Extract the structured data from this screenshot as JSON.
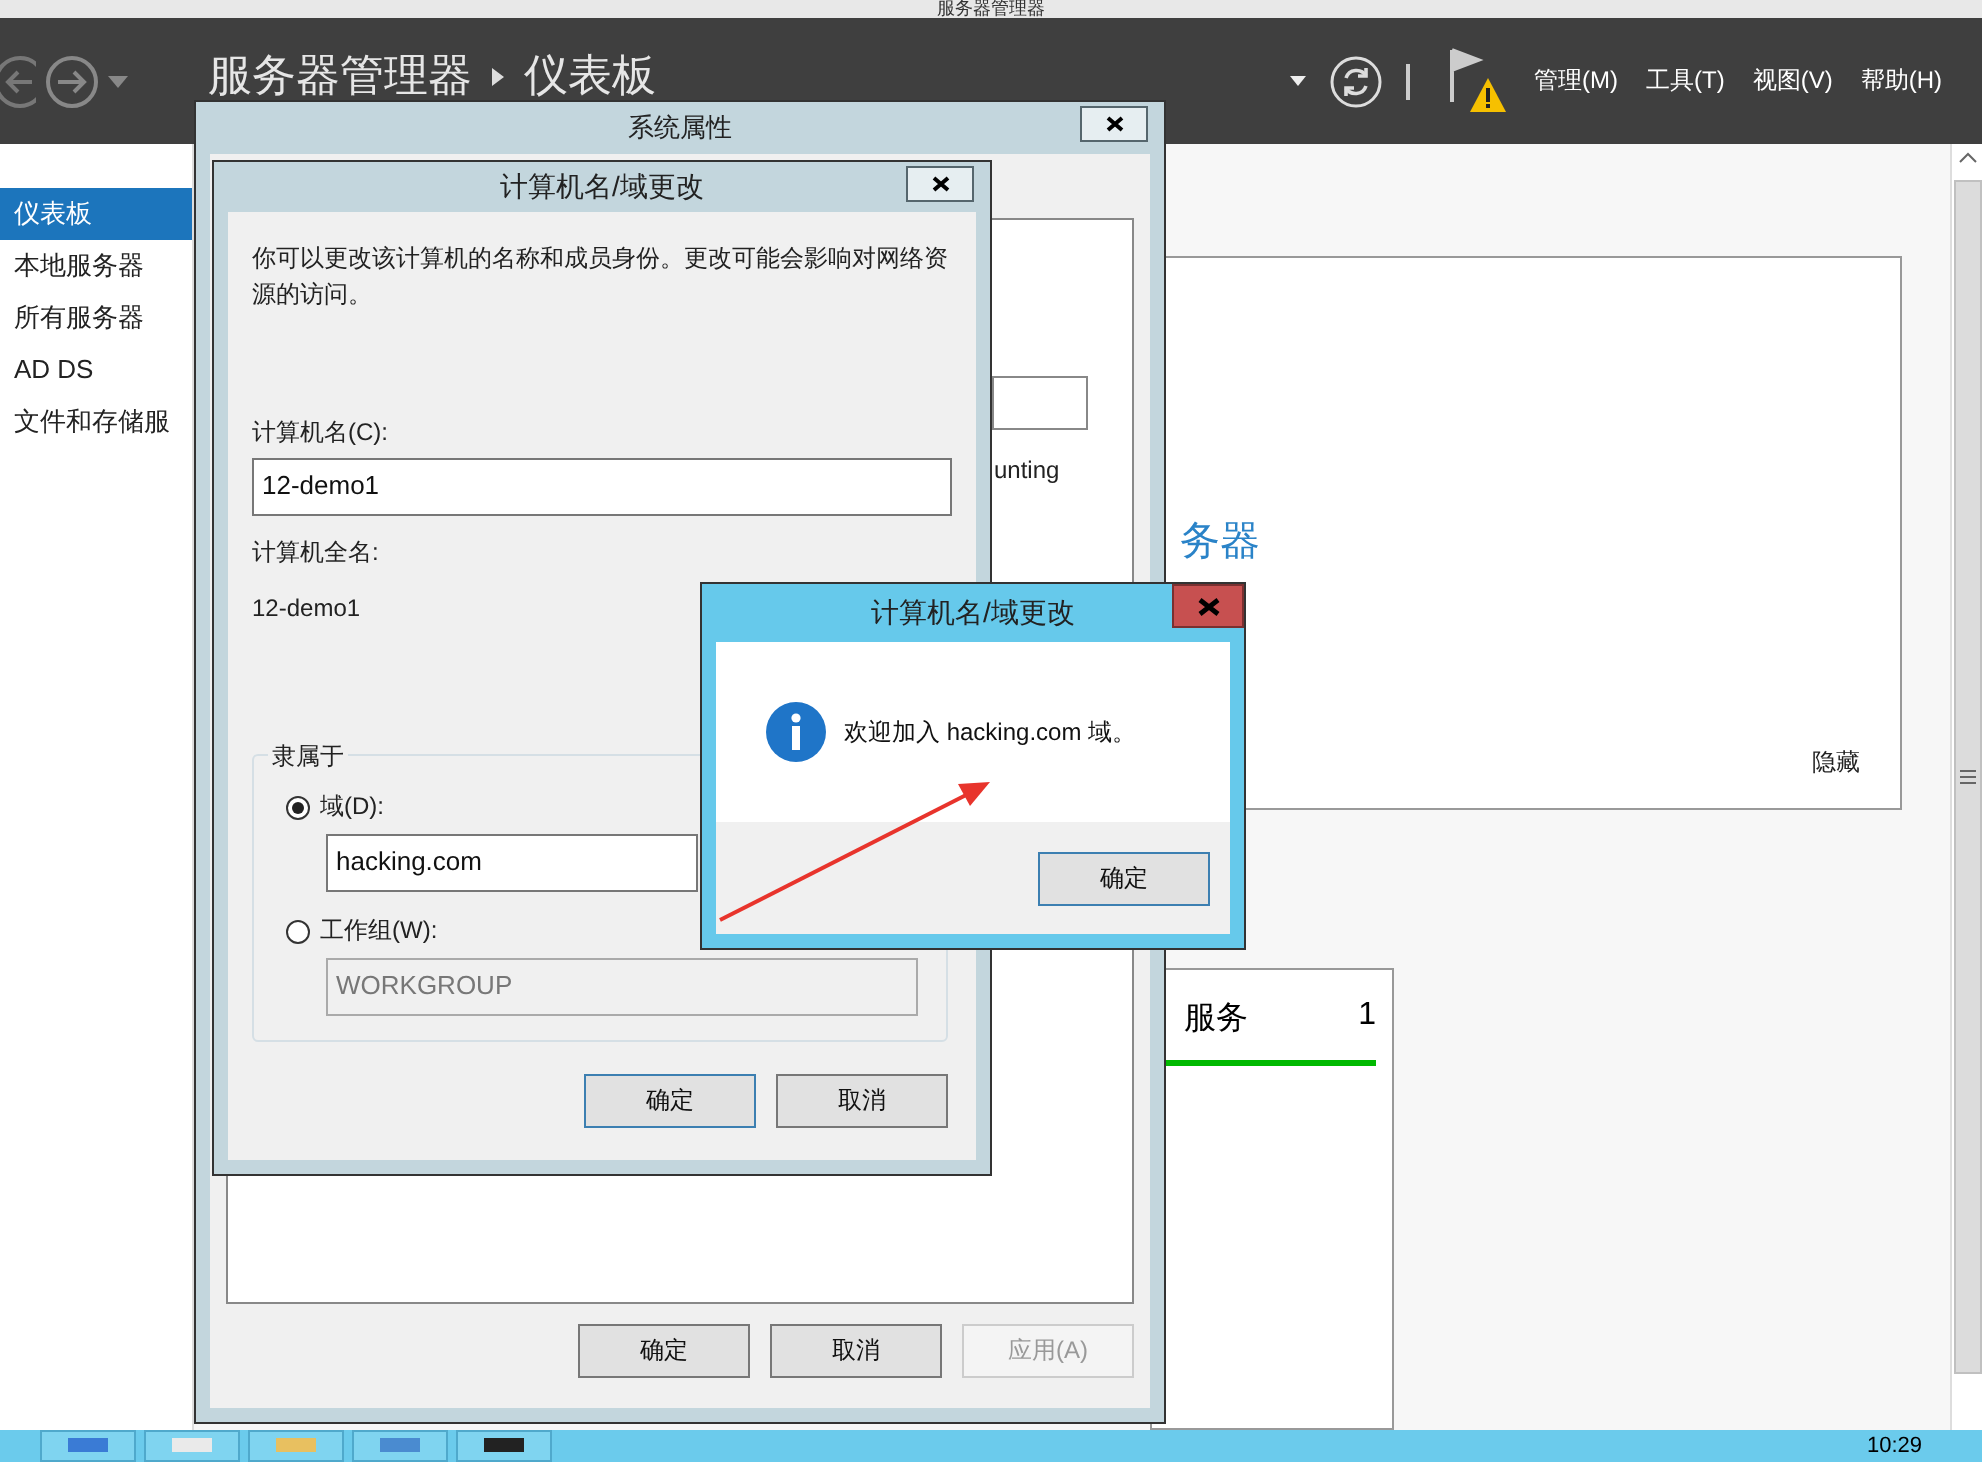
{
  "window": {
    "title": "服务器管理器"
  },
  "header": {
    "breadcrumb": [
      "服务器管理器",
      "仪表板"
    ],
    "menus": [
      "管理(M)",
      "工具(T)",
      "视图(V)",
      "帮助(H)"
    ]
  },
  "sidebar": {
    "items": [
      {
        "label": "仪表板",
        "selected": true
      },
      {
        "label": "本地服务器",
        "selected": false
      },
      {
        "label": "所有服务器",
        "selected": false
      },
      {
        "label": "AD DS",
        "selected": false
      },
      {
        "label": "文件和存储服",
        "selected": false
      }
    ]
  },
  "dashboard": {
    "panel_texts": [
      "务器"
    ],
    "hide_link": "隐藏",
    "tile": {
      "title": "服务",
      "count": "1"
    }
  },
  "system_properties": {
    "title": "系统属性",
    "snippet": "unting",
    "buttons": [
      {
        "label": "确定",
        "disabled": false
      },
      {
        "label": "取消",
        "disabled": false
      },
      {
        "label": "应用(A)",
        "disabled": true
      }
    ]
  },
  "computer_name_dialog": {
    "title": "计算机名/域更改",
    "description": "你可以更改该计算机的名称和成员身份。更改可能会影响对网络资源的访问。",
    "computer_name_label": "计算机名(C):",
    "computer_name": "12-demo1",
    "full_name_label": "计算机全名:",
    "full_name": "12-demo1",
    "member_of": {
      "legend": "隶属于",
      "options": [
        {
          "label": "域(D):",
          "selected": true,
          "value": "hacking.com"
        },
        {
          "label": "工作组(W):",
          "selected": false,
          "value": "WORKGROUP"
        }
      ]
    },
    "buttons": [
      "确定",
      "取消"
    ]
  },
  "message_box": {
    "title": "计算机名/域更改",
    "message": "欢迎加入 hacking.com 域。",
    "button": "确定"
  },
  "taskbar": {
    "clock": "10:29"
  }
}
